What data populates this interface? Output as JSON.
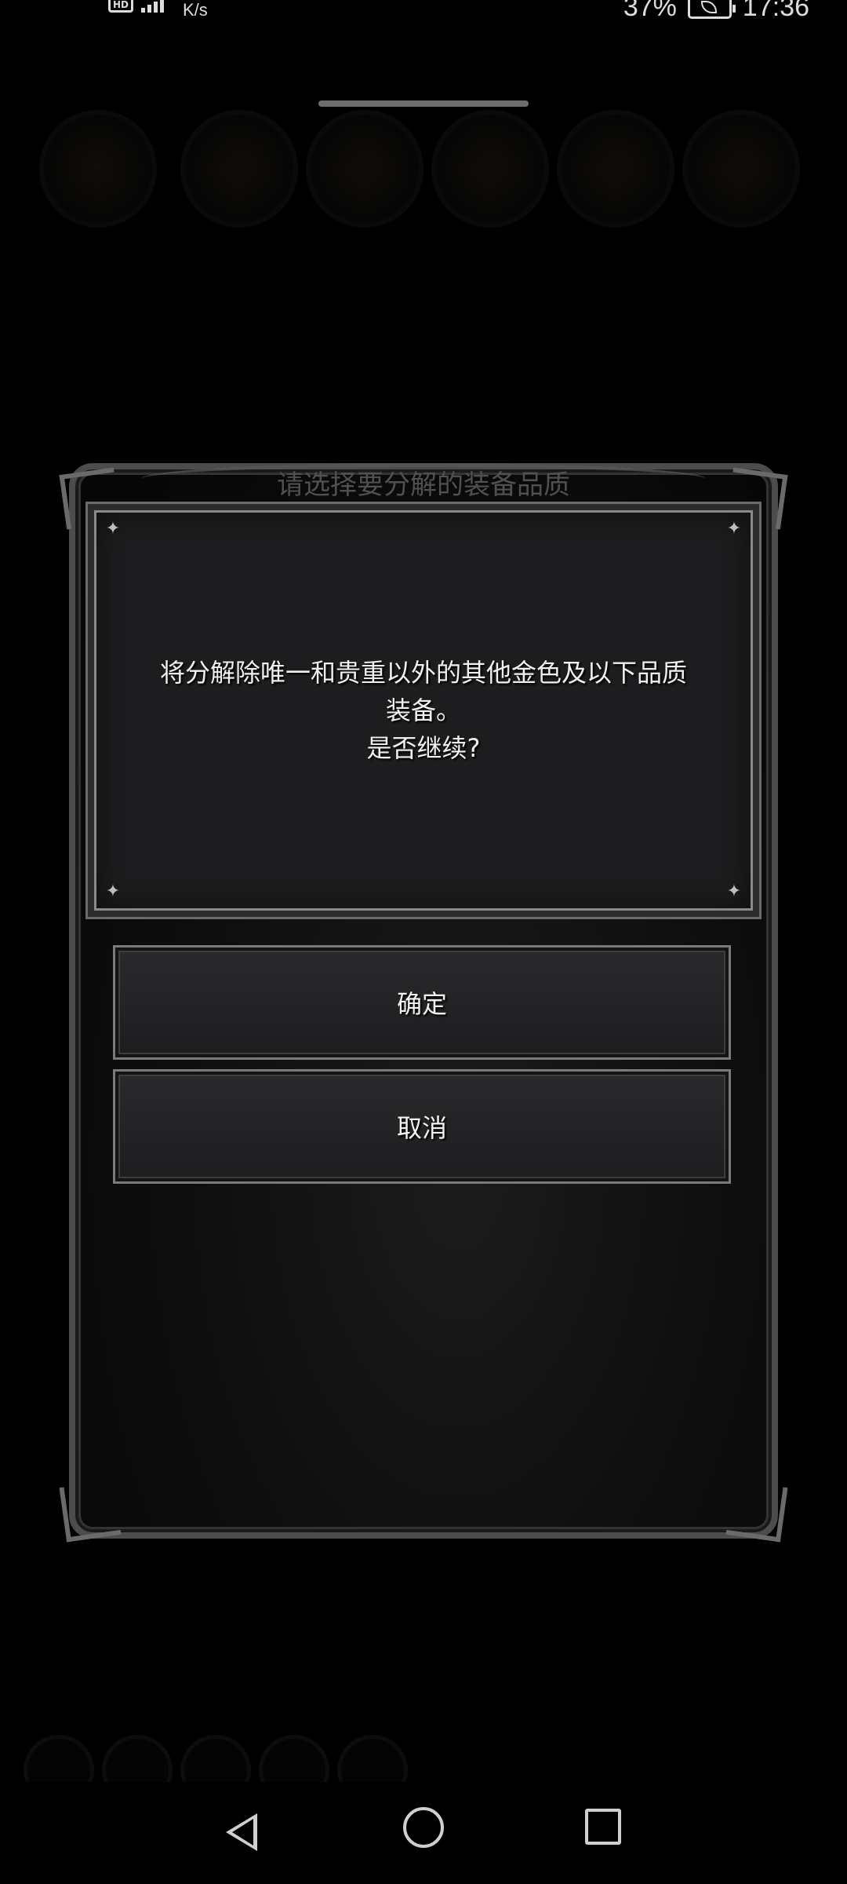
{
  "status_bar": {
    "network_speed": "K/s",
    "battery": "37%",
    "time": "17:36",
    "icons": [
      "hd-icon",
      "signal-icon",
      "battery-icon",
      "leaf-icon"
    ]
  },
  "background": {
    "title": "请选择要分解的装备品质"
  },
  "dialog": {
    "message": "将分解除唯一和贵重以外的其他金色及以下品质\n装备。\n是否继续?",
    "confirm_label": "确定",
    "cancel_label": "取消"
  },
  "nav_bar": {
    "icons": [
      "back-icon",
      "home-icon",
      "recent-apps-icon"
    ]
  }
}
